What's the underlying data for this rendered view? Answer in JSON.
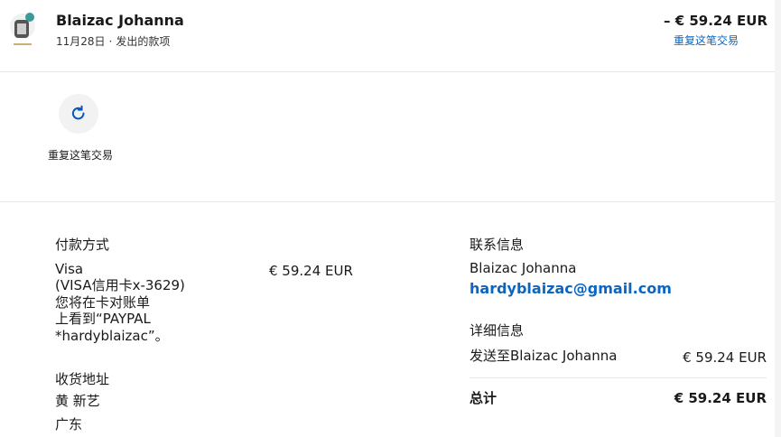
{
  "header": {
    "merchant_name": "Blaizac Johanna",
    "date": "11月28日",
    "separator": "·",
    "type": "发出的款项",
    "amount": "– € 59.24 EUR",
    "repeat_link": "重复这笔交易"
  },
  "actions": {
    "repeat_label": "重复这笔交易",
    "icon": "refresh-icon"
  },
  "payment": {
    "title": "付款方式",
    "method_lines": [
      "Visa",
      "(VISA信用卡x-3629)",
      "您将在卡对账单",
      "上看到“PAYPAL",
      "*hardyblaizac”。"
    ],
    "amount": "€ 59.24 EUR"
  },
  "shipping": {
    "title": "收货地址",
    "line1": "黄 新艺",
    "line2": "广东"
  },
  "contact": {
    "title": "联系信息",
    "name": "Blaizac Johanna",
    "email": "hardyblaizac@gmail.com"
  },
  "details": {
    "title": "详细信息",
    "sent_to": "发送至Blaizac Johanna",
    "sent_amount": "€ 59.24 EUR",
    "total_label": "总计",
    "total_amount": "€ 59.24 EUR"
  },
  "colors": {
    "link": "#0a66c2",
    "divider": "#e6e6e6"
  }
}
